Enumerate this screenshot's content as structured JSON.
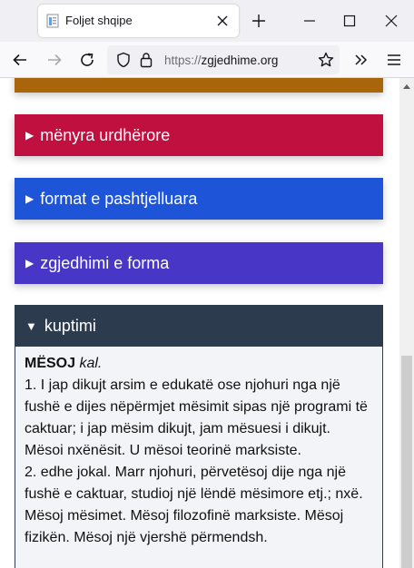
{
  "browser": {
    "tab_title": "Foljet shqipe",
    "url_protocol": "https://",
    "url_domain": "zgjedhime.org"
  },
  "sections": [
    {
      "label": "mënyra urdhërore",
      "color": "#c0103f"
    },
    {
      "label": "format e pashtjelluara",
      "color": "#1e54d8"
    },
    {
      "label": "zgjedhimi e forma",
      "color": "#4836c6"
    }
  ],
  "partial_section_color": "#a8650a",
  "kuptimi": {
    "header": "kuptimi",
    "headword": "MËSOJ",
    "grammar": "kal.",
    "definitions": [
      "1. I jap dikujt arsim e edukatë ose njohuri nga një fushë e dijes nëpërmjet mësimit sipas një programi të caktuar; i jap mësim dikujt, jam mësuesi i dikujt. Mësoi nxënësit. U mësoi teorinë marksiste.",
      "2. edhe jokal. Marr njohuri, përvetësoj dije nga një fushë e caktuar, studioj një lëndë mësimore etj.; nxë. Mësoj mësimet. Mësoj filozofinë marksiste. Mësoj fizikën. Mësoj një vjershë përmendsh."
    ]
  }
}
